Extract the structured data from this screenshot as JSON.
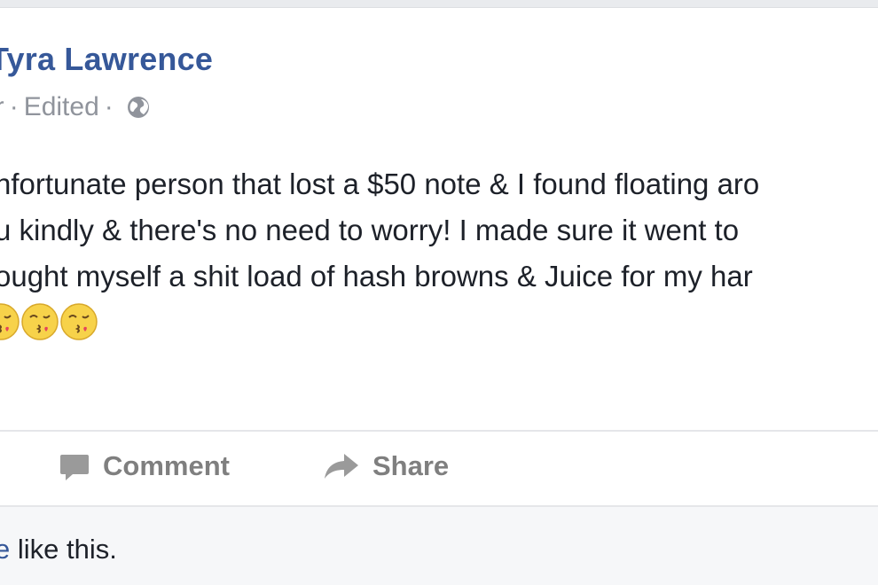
{
  "post": {
    "author": "Tyra Lawrence",
    "meta": {
      "time": "hr",
      "separator": "·",
      "edited": "Edited",
      "audience_icon": "globe-icon"
    },
    "text_lines": [
      "nfortunate person that lost a $50 note & I found floating aro",
      "u kindly & there's no need to worry! I made sure it went to",
      "ought myself a shit load of hash browns & Juice for my har"
    ],
    "emojis": [
      "kissing-face-emoji",
      "kissing-face-emoji",
      "kissing-face-emoji"
    ]
  },
  "actions": {
    "comment_label": "Comment",
    "share_label": "Share"
  },
  "footer": {
    "likes_prefix": "e",
    "likes_suffix": " like this."
  },
  "colors": {
    "author_link": "#365899",
    "meta_gray": "#90949c",
    "action_gray": "#7f7f7f",
    "body_text": "#1d2129",
    "footer_bg": "#f6f7f9"
  }
}
